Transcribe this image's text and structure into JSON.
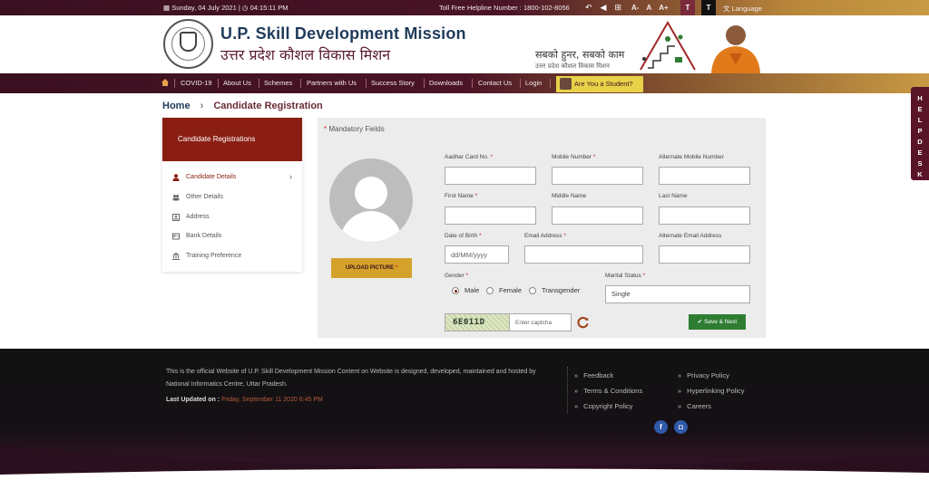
{
  "topbar": {
    "date": "Sunday, 04 July 2021",
    "time": "04:15:11 PM",
    "helpline": "Toll Free Helpline Number : 1800-102-8056",
    "font_sizes": [
      "A-",
      "A",
      "A+"
    ],
    "theme_light": "T",
    "theme_dark": "T",
    "language": "Language"
  },
  "header": {
    "title": "U.P. Skill Development Mission",
    "title_hindi": "उत्तर प्रदेश कौशल विकास मिशन",
    "slogan": "सबको हुनर, सबको काम",
    "slogan_sub": "उत्तर प्रदेश कौशल विकास मिशन"
  },
  "nav": {
    "items": [
      "COVID-19",
      "About Us",
      "Schemes",
      "Partners with Us",
      "Success Story",
      "Downloads",
      "Contact Us",
      "Login"
    ],
    "student_button": "Are You a Student?"
  },
  "helpdesk": [
    "H",
    "E",
    "L",
    "P",
    "D",
    "E",
    "S",
    "K"
  ],
  "breadcrumb": {
    "home": "Home",
    "separator": "›",
    "current": "Candidate Registration"
  },
  "sidebar": {
    "header": "Candidate Registrations",
    "items": [
      {
        "label": "Candidate Details",
        "icon": "user-icon",
        "active": true
      },
      {
        "label": "Other Details",
        "icon": "users-icon",
        "active": false
      },
      {
        "label": "Address",
        "icon": "address-card-icon",
        "active": false
      },
      {
        "label": "Bank Details",
        "icon": "bank-card-icon",
        "active": false
      },
      {
        "label": "Training Preference",
        "icon": "institution-icon",
        "active": false
      }
    ],
    "chevron": "›"
  },
  "form": {
    "mandatory_label": "Mandatory Fields",
    "required_mark": "*",
    "upload_button": "UPLOAD PICTURE",
    "labels": {
      "aadhar": "Aadhar Card No.",
      "mobile": "Mobile Number",
      "alt_mobile": "Alternate Mobile Number",
      "first_name": "First Name",
      "middle_name": "Middle Name",
      "last_name": "Last Name",
      "dob": "Date of Birth",
      "email": "Email Address",
      "alt_email": "Alternate Email Address",
      "gender": "Gender",
      "marital_status": "Marital Status"
    },
    "values": {
      "aadhar": "",
      "mobile": "",
      "alt_mobile": "",
      "first_name": "",
      "middle_name": "",
      "last_name": "",
      "email": "",
      "alt_email": "",
      "marital_status": "Single"
    },
    "placeholders": {
      "dob": "dd/MM/yyyy",
      "captcha": "Enter captcha"
    },
    "gender_options": [
      "Male",
      "Female",
      "Transgender"
    ],
    "gender_selected": "Male",
    "captcha_text": "6E011D",
    "save_button": "Save & Next"
  },
  "footer": {
    "text": "This is the official Website of U.P. Skill Development Mission Content on Website is designed, developed, maintained and hosted by National Informatics Centre, Uttar Pradesh.",
    "last_updated_label": "Last Updated on :",
    "last_updated_value": "Friday, September 11 2020 6:45 PM",
    "links_col1": [
      "Feedback",
      "Terms & Conditions",
      "Copyright Policy"
    ],
    "links_col2": [
      "Privacy Policy",
      "Hyperlinking Policy",
      "Careers"
    ],
    "link_arrow": "»",
    "social": [
      {
        "icon": "facebook-icon",
        "glyph": "f"
      },
      {
        "icon": "instagram-icon",
        "glyph": "◘"
      }
    ]
  },
  "colors": {
    "maroon": "#4a1426",
    "gold": "#c89a44",
    "sidebar_header": "#8a1e12",
    "upload_button": "#d4a22a",
    "save_button": "#2e7d32",
    "helpdesk": "#5a1428"
  }
}
